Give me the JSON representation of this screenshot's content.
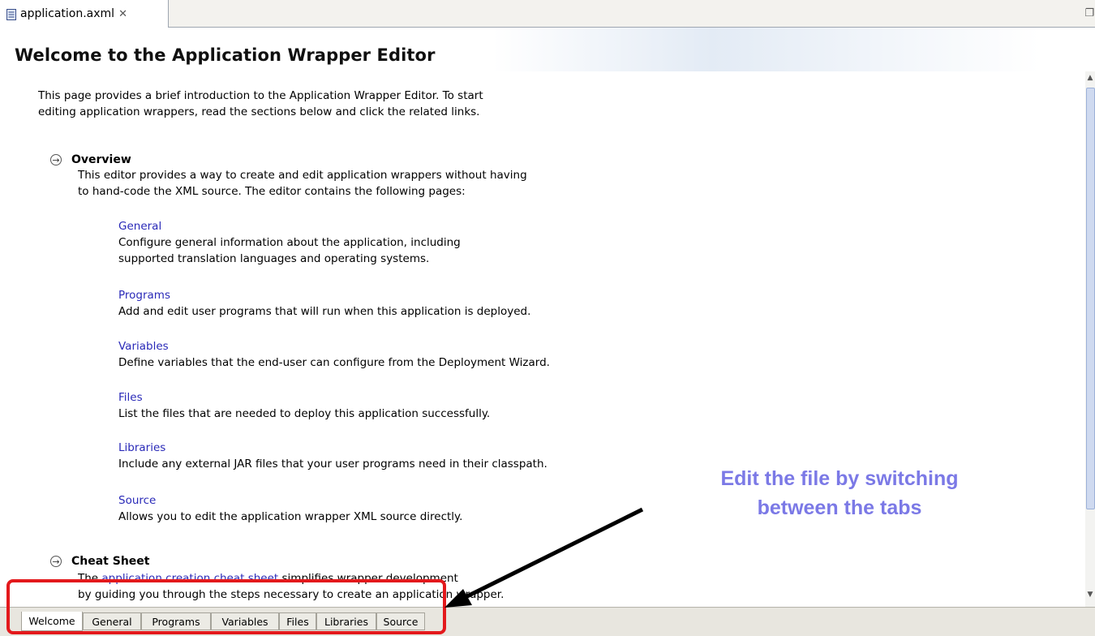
{
  "editor": {
    "file_tab_label": "application.axml",
    "close_glyph": "✕",
    "maximize_glyph": "❐"
  },
  "page_title": "Welcome to the Application Wrapper Editor",
  "intro_line1": "This page provides a brief introduction to the Application Wrapper Editor. To start",
  "intro_line2": "editing application wrappers, read the sections below and click the related links.",
  "overview": {
    "title": "Overview",
    "desc_line1": "This editor provides a way to create and edit application wrappers without having",
    "desc_line2": "to hand-code the XML source. The editor contains the following pages:"
  },
  "pages": [
    {
      "link": "General",
      "desc_line1": "Configure general information about the application, including",
      "desc_line2": "supported translation languages and operating systems."
    },
    {
      "link": "Programs",
      "desc_line1": "Add and edit user programs that will run when this application is deployed."
    },
    {
      "link": "Variables",
      "desc_line1": "Define variables that the end-user can configure from the Deployment Wizard."
    },
    {
      "link": "Files",
      "desc_line1": "List the files that are needed to deploy this application successfully."
    },
    {
      "link": "Libraries",
      "desc_line1": "Include any external JAR files that your user programs need in their classpath."
    },
    {
      "link": "Source",
      "desc_line1": "Allows you to edit the application wrapper XML source directly."
    }
  ],
  "cheat_sheet": {
    "title": "Cheat Sheet",
    "prefix": "The ",
    "link": "application creation cheat sheet",
    "suffix": " simplifies wrapper development",
    "line2": "by guiding you through the steps necessary to create an application wrapper."
  },
  "bottom_tabs": [
    "Welcome",
    "General",
    "Programs",
    "Variables",
    "Files",
    "Libraries",
    "Source"
  ],
  "active_tab": "Welcome",
  "annotation": {
    "line1": "Edit the file by switching",
    "line2": "between the tabs"
  },
  "colors": {
    "link": "#2a2ab8",
    "annotation": "#7b79e6",
    "highlight": "#e3191c",
    "arrow": "#000000"
  },
  "icons": {
    "file": "file-icon",
    "section": "arrow-circle-icon",
    "scroll_up": "scroll-up-icon",
    "scroll_down": "scroll-down-icon",
    "maximize": "maximize-icon"
  }
}
